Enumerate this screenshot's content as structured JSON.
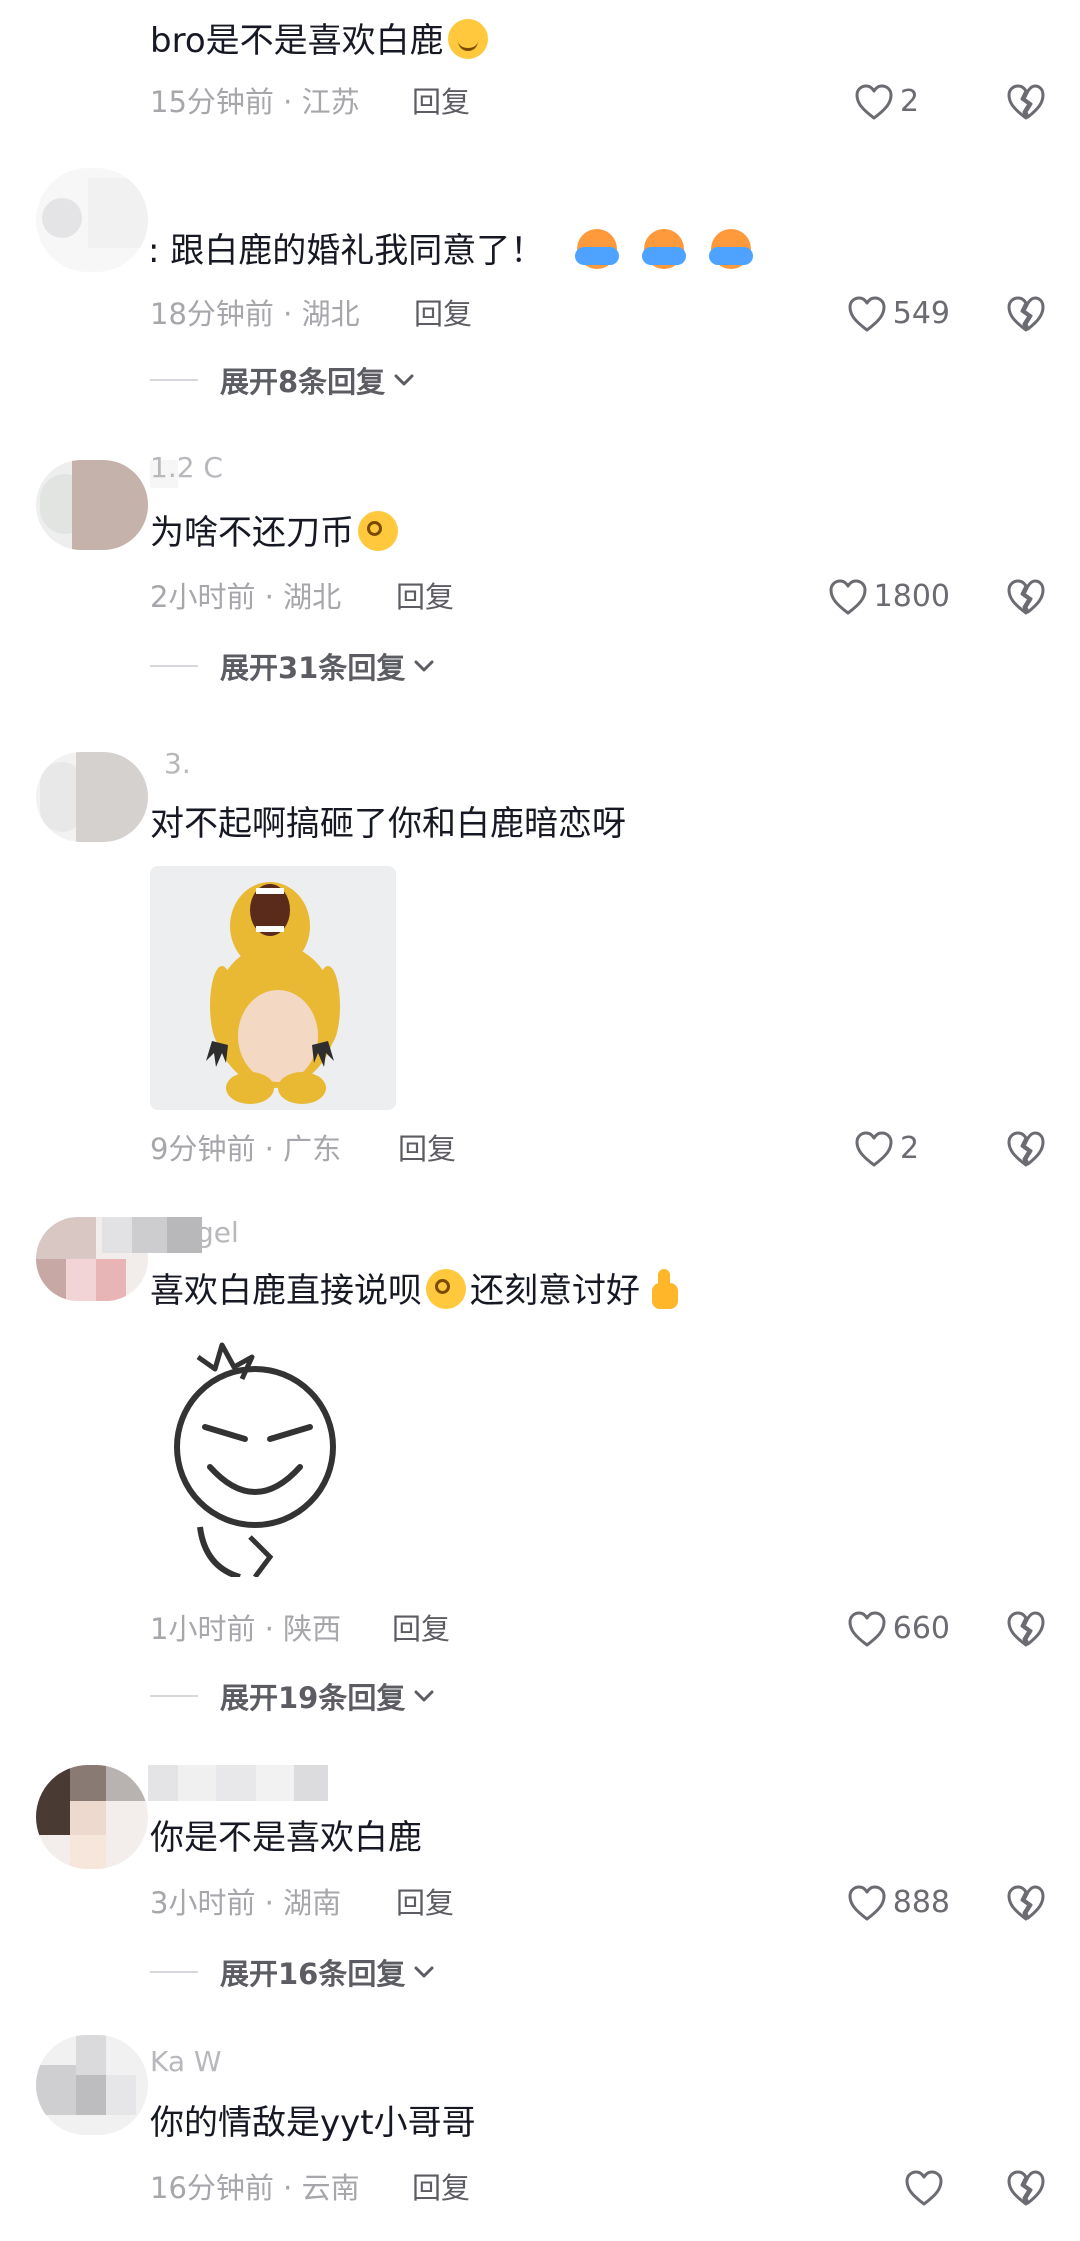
{
  "comments": [
    {
      "text": "bro是不是喜欢白鹿",
      "time": "15分钟前",
      "location": "江苏",
      "reply": "回复",
      "likes": "2"
    },
    {
      "text": ": 跟白鹿的婚礼我同意了！",
      "time": "18分钟前",
      "location": "湖北",
      "reply": "回复",
      "likes": "549",
      "expand": "展开8条回复"
    },
    {
      "username": "1.2 C",
      "text": "为啥不还刀币",
      "time": "2小时前",
      "location": "湖北",
      "reply": "回复",
      "likes": "1800",
      "expand": "展开31条回复"
    },
    {
      "username": "3.",
      "text": "对不起啊搞砸了你和白鹿暗恋呀",
      "time": "9分钟前",
      "location": "广东",
      "reply": "回复",
      "likes": "2"
    },
    {
      "username": "gel",
      "text_a": "喜欢白鹿直接说呗",
      "text_b": "还刻意讨好",
      "time": "1小时前",
      "location": "陕西",
      "reply": "回复",
      "likes": "660",
      "expand": "展开19条回复"
    },
    {
      "text": "你是不是喜欢白鹿",
      "time": "3小时前",
      "location": "湖南",
      "reply": "回复",
      "likes": "888",
      "expand": "展开16条回复"
    },
    {
      "username": "Ka W",
      "text": "你的情敌是yyt小哥哥",
      "time": "16分钟前",
      "location": "云南",
      "reply": "回复",
      "likes": ""
    }
  ],
  "meta_separator": " · ",
  "icons": {
    "like": "heart-outline-icon",
    "dislike": "broken-heart-icon",
    "expand": "chevron-down-icon"
  },
  "colors": {
    "text": "#161823",
    "meta": "#a6a6ab",
    "reply": "#5c5c63"
  }
}
